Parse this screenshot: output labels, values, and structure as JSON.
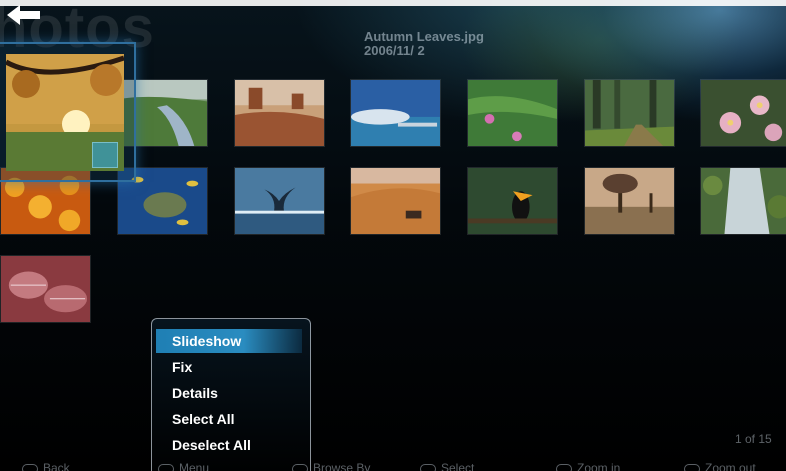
{
  "header": {
    "section_title": "hotos",
    "file_name": "Autumn Leaves.jpg",
    "file_date": "2006/11/ 2"
  },
  "gallery": {
    "items": [
      {
        "name": "autumn-leaves",
        "row": 0,
        "col": 0,
        "focused": true
      },
      {
        "name": "creek",
        "row": 0,
        "col": 1
      },
      {
        "name": "desert-landscape",
        "row": 0,
        "col": 2
      },
      {
        "name": "dock",
        "row": 0,
        "col": 3
      },
      {
        "name": "forest-flowers",
        "row": 0,
        "col": 4
      },
      {
        "name": "forest",
        "row": 0,
        "col": 5
      },
      {
        "name": "frangipani-flowers",
        "row": 0,
        "col": 6
      },
      {
        "name": "garden",
        "row": 1,
        "col": 0
      },
      {
        "name": "green-sea-turtle",
        "row": 1,
        "col": 1
      },
      {
        "name": "humpback-whale",
        "row": 1,
        "col": 2
      },
      {
        "name": "oryx-antelope",
        "row": 1,
        "col": 3
      },
      {
        "name": "toco-toucan",
        "row": 1,
        "col": 4
      },
      {
        "name": "tree",
        "row": 1,
        "col": 5
      },
      {
        "name": "waterfall",
        "row": 1,
        "col": 6
      },
      {
        "name": "winter-leaves",
        "row": 2,
        "col": 0
      }
    ]
  },
  "context_menu": {
    "items": [
      "Slideshow",
      "Fix",
      "Details",
      "Select All",
      "Deselect All"
    ],
    "selected_index": 0,
    "selected_color": "#1f7fb4"
  },
  "pagination": {
    "label": "1 of 15"
  },
  "footer": {
    "hints": [
      "Back",
      "Menu",
      "Browse By",
      "Select",
      "Zoom in",
      "Zoom out"
    ]
  },
  "colors": {
    "accent": "#2f6f9e",
    "background": "#000000"
  }
}
